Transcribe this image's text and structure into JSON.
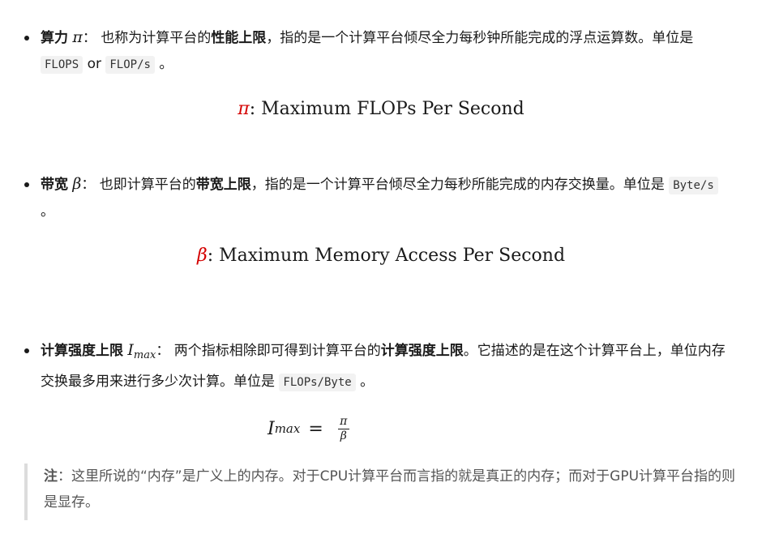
{
  "item1": {
    "term": "算力",
    "symbol": "π",
    "colon": "：",
    "text_a": "也称为计算平台的",
    "bold_a": "性能上限",
    "text_b": "，指的是一个计算平台倾尽全力每秒钟所能完成的浮点运算数。单位是",
    "code1": "FLOPS",
    "or": "or",
    "code2": "FLOP/s",
    "end": "。"
  },
  "formula1": {
    "symbol": "π",
    "text": ": Maximum FLOPs Per Second"
  },
  "item2": {
    "term": "带宽",
    "symbol": "β",
    "colon": "：",
    "text_a": "也即计算平台的",
    "bold_a": "带宽上限",
    "text_b": "，指的是一个计算平台倾尽全力每秒所能完成的内存交换量。单位是",
    "code1": "Byte/s",
    "end": "。"
  },
  "formula2": {
    "symbol": "β",
    "text": ": Maximum Memory Access Per Second"
  },
  "item3": {
    "term": "计算强度上限",
    "symbol": "I",
    "symbol_sub": "max",
    "colon": "：",
    "text_a": "两个指标相除即可得到计算平台的",
    "bold_a": "计算强度上限",
    "text_b": "。它描述的是在这个计算平台上，单位内存交换最多用来进行多少次计算。单位是",
    "code1": "FLOPs/Byte",
    "end": "。"
  },
  "formula3": {
    "lhs": "I",
    "lhs_sub": "max",
    "eq": "=",
    "num": "π",
    "den": "β"
  },
  "note": {
    "label": "注",
    "text": "：这里所说的“内存”是广义上的内存。对于CPU计算平台而言指的就是真正的内存；而对于GPU计算平台指的则是显存。"
  }
}
